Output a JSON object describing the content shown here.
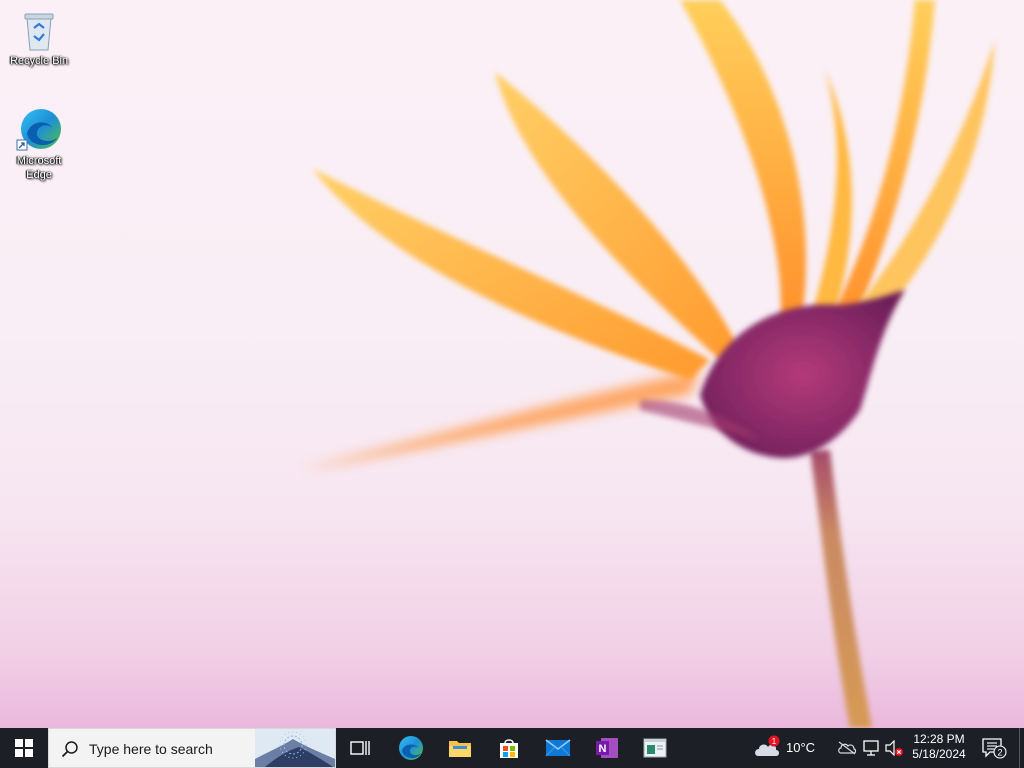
{
  "desktop": {
    "icons": [
      {
        "label": "Recycle Bin",
        "icon": "recycle-bin-icon"
      },
      {
        "label": "Microsoft Edge",
        "icon": "microsoft-edge-icon"
      }
    ],
    "wallpaper": "pink-background-with-orange-flower"
  },
  "taskbar": {
    "start_icon": "windows-logo-icon",
    "search": {
      "placeholder": "Type here to search",
      "icon": "search-icon"
    },
    "pinned": [
      {
        "name": "Task View",
        "icon": "task-view-icon"
      },
      {
        "name": "Microsoft Edge",
        "icon": "microsoft-edge-icon"
      },
      {
        "name": "File Explorer",
        "icon": "folder-icon"
      },
      {
        "name": "Microsoft Store",
        "icon": "store-icon"
      },
      {
        "name": "Mail",
        "icon": "mail-icon"
      },
      {
        "name": "OneNote",
        "icon": "onenote-icon"
      },
      {
        "name": "App",
        "icon": "window-app-icon"
      }
    ],
    "tray": {
      "weather": {
        "temp": "10°C",
        "badge": "1",
        "icon": "cloud-weather-icon"
      },
      "icons": [
        "onedrive-icon",
        "network-icon",
        "volume-muted-icon"
      ],
      "clock": {
        "time": "12:28 PM",
        "date": "5/18/2024"
      },
      "notifications": {
        "count": "2",
        "icon": "action-center-icon"
      }
    },
    "colors": {
      "background": "#1c1f26",
      "search_bg": "#f3f3f3"
    }
  }
}
